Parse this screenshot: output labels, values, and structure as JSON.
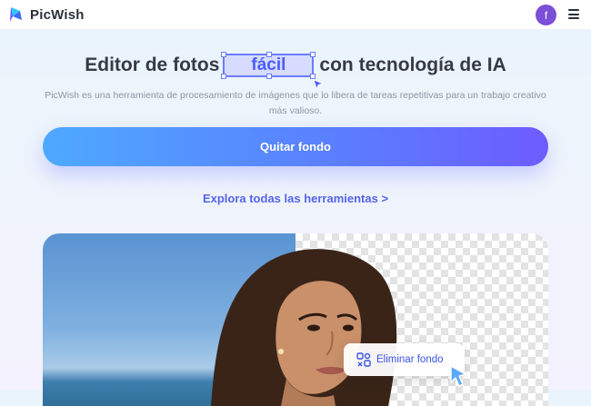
{
  "header": {
    "brand": "PicWish",
    "avatar_initial": "f",
    "logo_icon": "picwish-logo-icon",
    "menu_icon": "hamburger-menu-icon"
  },
  "hero": {
    "headline_before": "Editor de fotos",
    "headline_highlight": "fácil",
    "headline_after": "con tecnología de IA",
    "subtitle": "PicWish es una herramienta de procesamiento de imágenes que lo libera de tareas repetitivas para un trabajo creativo más valioso.",
    "cta_label": "Quitar fondo",
    "explore_label": "Explora todas las herramientas >"
  },
  "showcase": {
    "badge_label": "Eliminar fondo",
    "badge_icon": "background-remove-icon",
    "cursor_icon": "pointer-cursor-icon"
  },
  "colors": {
    "accent": "#5564e8",
    "cta_start": "#4ea9ff",
    "cta_end": "#6d5cff",
    "highlight_border": "#6a7dff",
    "avatar": "#7b4fd6"
  }
}
